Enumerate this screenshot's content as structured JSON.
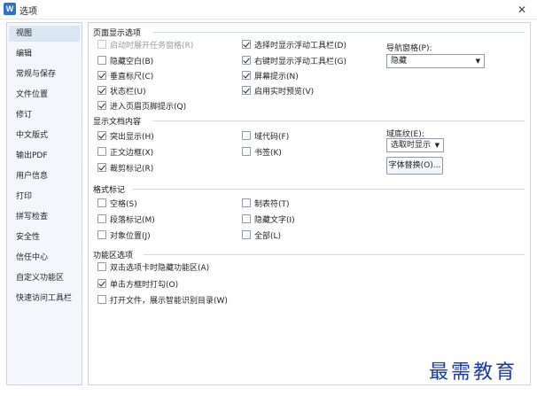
{
  "window": {
    "title": "选项",
    "app_icon": "W",
    "close_symbol": "✕"
  },
  "sidebar": {
    "items": [
      {
        "label": "视图",
        "active": true
      },
      {
        "label": "编辑"
      },
      {
        "label": "常规与保存"
      },
      {
        "label": "文件位置"
      },
      {
        "label": "修订"
      },
      {
        "label": "中文版式"
      },
      {
        "label": "输出PDF"
      },
      {
        "label": "用户信息"
      },
      {
        "label": "打印"
      },
      {
        "label": "拼写检查"
      },
      {
        "label": "安全性"
      },
      {
        "label": "信任中心"
      },
      {
        "label": "自定义功能区"
      },
      {
        "label": "快速访问工具栏"
      }
    ]
  },
  "page_display": {
    "heading": "页面显示选项",
    "options": [
      {
        "label": "启动时展开任务窗格(R)",
        "checked": false,
        "disabled": true
      },
      {
        "label": "隐藏空白(B)",
        "checked": false
      },
      {
        "label": "垂直标尺(C)",
        "checked": true
      },
      {
        "label": "状态栏(U)",
        "checked": true
      },
      {
        "label": "进入页眉页脚提示(Q)",
        "checked": true
      },
      {
        "label": "选择时显示浮动工具栏(D)",
        "checked": true
      },
      {
        "label": "右键时显示浮动工具栏(G)",
        "checked": true
      },
      {
        "label": "屏幕提示(N)",
        "checked": true
      },
      {
        "label": "启用实时预览(V)",
        "checked": true
      }
    ],
    "nav_pane_label": "导航窗格(P):",
    "nav_pane_value": "隐藏"
  },
  "doc_content": {
    "heading": "显示文档内容",
    "options": [
      {
        "label": "突出显示(H)",
        "checked": true
      },
      {
        "label": "正文边框(X)",
        "checked": false
      },
      {
        "label": "裁剪标记(R)",
        "checked": true
      },
      {
        "label": "域代码(F)",
        "checked": false
      },
      {
        "label": "书签(K)",
        "checked": false
      }
    ],
    "field_shading_label": "域底纹(E):",
    "field_shading_value": "选取时显示",
    "font_replace_button": "字体替换(O)..."
  },
  "format_marks": {
    "heading": "格式标记",
    "options": [
      {
        "label": "空格(S)",
        "checked": false
      },
      {
        "label": "段落标记(M)",
        "checked": false
      },
      {
        "label": "对象位置(J)",
        "checked": false
      },
      {
        "label": "制表符(T)",
        "checked": false
      },
      {
        "label": "隐藏文字(I)",
        "checked": false
      },
      {
        "label": "全部(L)",
        "checked": false
      }
    ]
  },
  "ribbon": {
    "heading": "功能区选项",
    "options": [
      {
        "label": "双击选项卡时隐藏功能区(A)",
        "checked": false
      },
      {
        "label": "单击方框时打勾(O)",
        "checked": true
      },
      {
        "label": "打开文件，展示智能识别目录(W)",
        "checked": false
      }
    ]
  },
  "watermark": "最需教育"
}
